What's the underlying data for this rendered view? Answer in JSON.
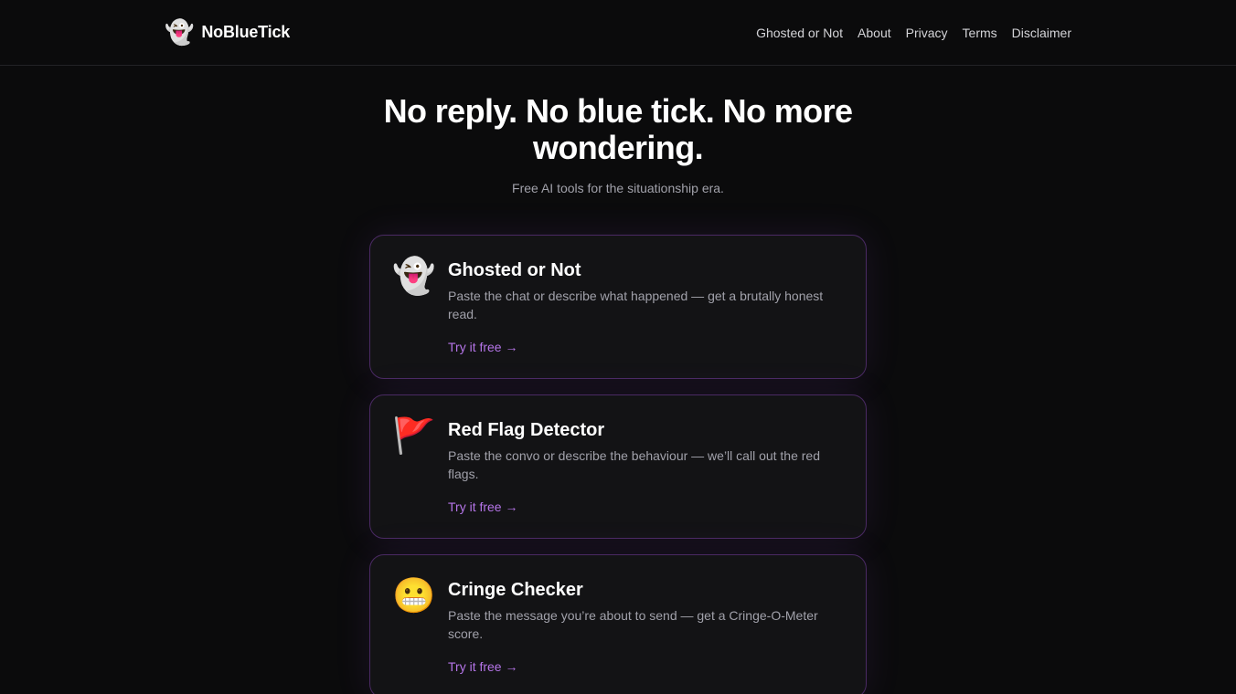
{
  "header": {
    "brand_icon": "👻",
    "brand_name": "NoBlueTick",
    "nav": [
      {
        "label": "Ghosted or Not"
      },
      {
        "label": "About"
      },
      {
        "label": "Privacy"
      },
      {
        "label": "Terms"
      },
      {
        "label": "Disclaimer"
      }
    ]
  },
  "hero": {
    "title": "No reply. No blue tick. No more wondering.",
    "subtitle": "Free AI tools for the situationship era."
  },
  "tools": [
    {
      "icon": "👻",
      "icon_name": "ghost-icon",
      "title": "Ghosted or Not",
      "description": "Paste the chat or describe what happened — get a brutally honest read.",
      "cta": "Try it free →"
    },
    {
      "icon": "🚩",
      "icon_name": "red-flag-icon",
      "title": "Red Flag Detector",
      "description": "Paste the convo or describe the behaviour — we’ll call out the red flags.",
      "cta": "Try it free →"
    },
    {
      "icon": "😬",
      "icon_name": "grimacing-face-icon",
      "title": "Cringe Checker",
      "description": "Paste the message you’re about to send — get a Cringe-O-Meter score.",
      "cta": "Try it free →"
    }
  ],
  "colors": {
    "background": "#0b0b0c",
    "card_background": "#131315",
    "card_border": "#4a2a63",
    "accent": "#b575e8",
    "muted_text": "#a1a1aa"
  }
}
